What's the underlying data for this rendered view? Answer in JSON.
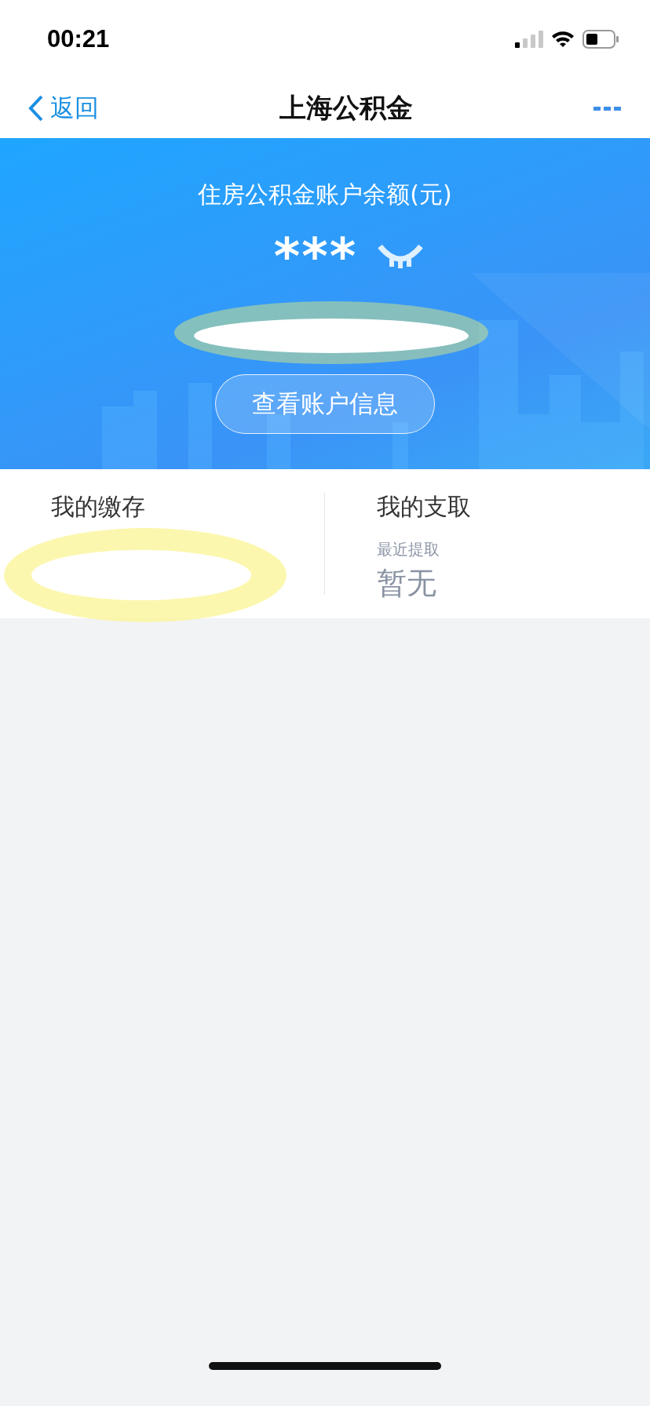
{
  "status_bar": {
    "time": "00:21"
  },
  "nav": {
    "back": "返回",
    "title": "上海公积金"
  },
  "balance": {
    "label": "住房公积金账户余额(元)",
    "value": "***",
    "hidden": true,
    "button": "查看账户信息"
  },
  "cards": [
    {
      "title": "我的缴存",
      "redacted": true
    },
    {
      "title": "我的支取",
      "subtitle": "最近提取",
      "value": "暂无",
      "redacted": false
    }
  ]
}
